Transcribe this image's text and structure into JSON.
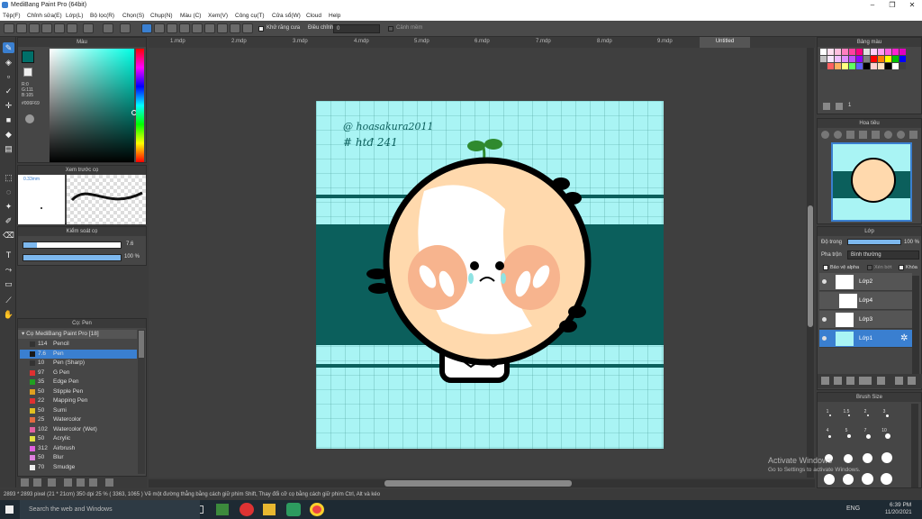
{
  "app": {
    "title": "MediBang Paint Pro (64bit)"
  },
  "menu": [
    "Tệp(F)",
    "Chỉnh sửa(E)",
    "Lớp(L)",
    "Bộ lọc(R)",
    "Chọn(S)",
    "Chụp(N)",
    "Màu (C)",
    "Xem(V)",
    "Công cụ(T)",
    "Cửa sổ(W)",
    "Cloud",
    "Help"
  ],
  "toolbar": {
    "antialias_label": "Khử răng cưa",
    "adjust_label": "Điều chỉnh",
    "adjust_value": "0",
    "warning_label": "Cảnh mềm"
  },
  "tabs": [
    "1.mdp",
    "2.mdp",
    "3.mdp",
    "4.mdp",
    "5.mdp",
    "6.mdp",
    "7.mdp",
    "8.mdp",
    "9.mdp",
    "Untitled"
  ],
  "color_panel": {
    "title": "Màu",
    "r": "R:0",
    "g": "G:111",
    "b": "B:105",
    "hex": "#006F69"
  },
  "preview_panel": {
    "title": "Xem trước cọ",
    "size": "0.33mm"
  },
  "brush_control": {
    "title": "Kiểm soát cọ",
    "size_value": "7.6",
    "opacity_value": "100 %"
  },
  "brush_panel": {
    "title": "Cọ: Pen",
    "group": "Cọ MediBang Paint Pro [18]",
    "items": [
      {
        "num": "114",
        "name": "Pencil",
        "color": "#333333"
      },
      {
        "num": "7.6",
        "name": "Pen",
        "color": "#1a1a1a"
      },
      {
        "num": "10",
        "name": "Pen (Sharp)",
        "color": "#333333"
      },
      {
        "num": "97",
        "name": "G Pen",
        "color": "#e03030"
      },
      {
        "num": "35",
        "name": "Edge Pen",
        "color": "#20a020"
      },
      {
        "num": "50",
        "name": "Stipple Pen",
        "color": "#e0a020"
      },
      {
        "num": "22",
        "name": "Mapping Pen",
        "color": "#e03030"
      },
      {
        "num": "50",
        "name": "Sumi",
        "color": "#e0c020"
      },
      {
        "num": "25",
        "name": "Watercolor",
        "color": "#e06a40"
      },
      {
        "num": "102",
        "name": "Watercolor (Wet)",
        "color": "#e060a0"
      },
      {
        "num": "50",
        "name": "Acrylic",
        "color": "#e0e040"
      },
      {
        "num": "312",
        "name": "Airbrush",
        "color": "#e060e0"
      },
      {
        "num": "50",
        "name": "Blur",
        "color": "#e080e0"
      },
      {
        "num": "70",
        "name": "Smudge",
        "color": "#eeeeee"
      }
    ]
  },
  "palette_panel": {
    "title": "Bảng màu",
    "page": "1"
  },
  "navigator_panel": {
    "title": "Hoa tiêu"
  },
  "layer_panel": {
    "title": "Lớp",
    "opacity_label": "Độ trong",
    "opacity_value": "100 %",
    "blend_label": "Pha trộn",
    "blend_value": "Bình thường",
    "protect_alpha": "Bảo vệ alpha",
    "clipping": "Xén bớt",
    "lock": "Khóa",
    "layers": [
      {
        "name": "Lớp2"
      },
      {
        "name": "Lớp4"
      },
      {
        "name": "Lớp3"
      },
      {
        "name": "Lớp1"
      }
    ]
  },
  "brush_size_panel": {
    "title": "Brush Size",
    "sizes": [
      "1",
      "1.5",
      "2",
      "3",
      "4",
      "5",
      "7",
      "10"
    ]
  },
  "canvas": {
    "text_line1": "@ hoasakura2011",
    "text_line2": "# htđ 241",
    "bg": "#a9f4f4",
    "band": "#0b5f5c"
  },
  "status": {
    "text": "2893 * 2893 pixel   (21 * 21cm)   350 dpi   25 %   ( 3363, 1065 )   Vẽ một đường thẳng bằng cách giữ phím Shift, Thay đổi cỡ cọ bằng cách giữ phím Ctrl, Alt và kéo"
  },
  "watermark": {
    "line1": "Activate Windows",
    "line2": "Go to Settings to activate Windows."
  },
  "taskbar": {
    "search": "Search the web and Windows",
    "lang": "ENG",
    "time": "6:39 PM",
    "date": "11/20/2021"
  }
}
